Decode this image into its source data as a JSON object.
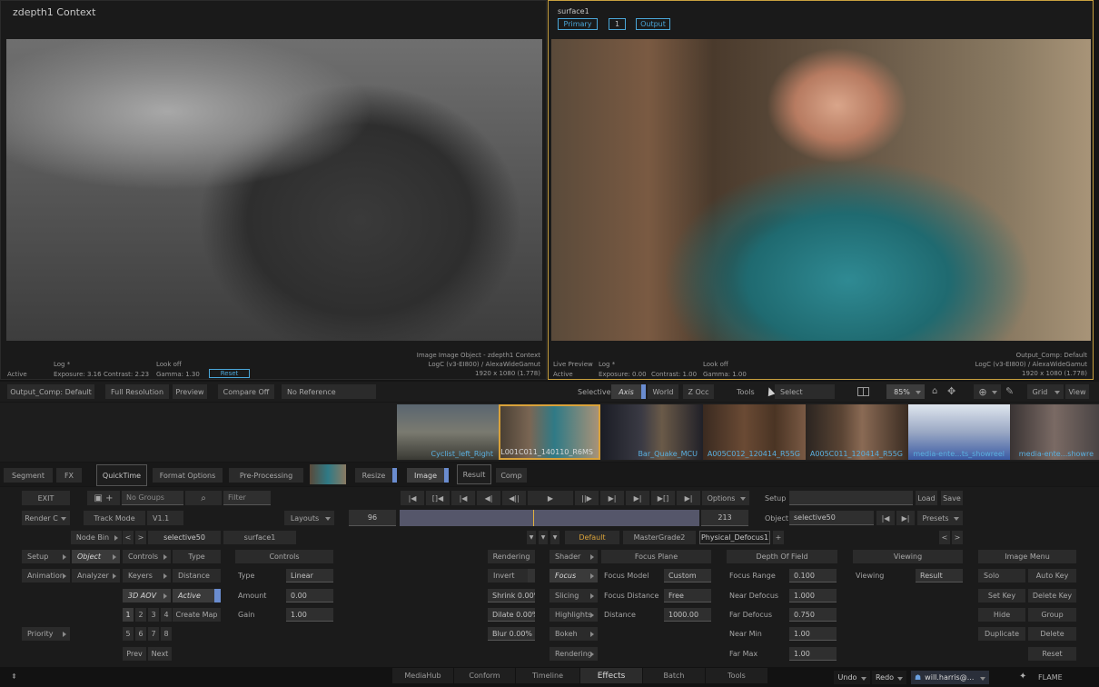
{
  "left_viewer": {
    "title": "zdepth1 Context",
    "log": "Log *",
    "look": "Look off",
    "status": "Active",
    "exposure": "Exposure: 3.16",
    "contrast": "Contrast: 2.23",
    "gamma": "Gamma: 1.30",
    "reset": "Reset",
    "info1": "Image Image Object - zdepth1 Context",
    "info2": "LogC (v3-EI800) / AlexaWideGamut",
    "info3": "1920 x 1080 (1.778)"
  },
  "right_viewer": {
    "title": "surface1",
    "btn_primary": "Primary",
    "btn_num": "1",
    "btn_output": "Output",
    "live": "Live Preview",
    "log": "Log *",
    "look": "Look off",
    "status": "Active",
    "exposure": "Exposure: 0.00",
    "contrast": "Contrast: 1.00",
    "gamma": "Gamma: 1.00",
    "info1": "Output_Comp: Default",
    "info2": "LogC (v3-EI800) / AlexaWideGamut",
    "info3": "1920 x 1080 (1.778)"
  },
  "viewer_bar": {
    "output": "Output_Comp: Default",
    "full_res": "Full Resolution",
    "preview": "Preview",
    "compare": "Compare Off",
    "noref": "No Reference",
    "selective": "Selective",
    "axis": "Axis",
    "world": "World",
    "zocc": "Z Occ",
    "tools": "Tools",
    "select": "Select",
    "zoom": "85%",
    "grid": "Grid",
    "view": "View"
  },
  "thumbs": [
    "Cyclist_left_Right",
    "L001C011_140110_R6MS",
    "Bar_Quake_MCU",
    "A005C012_120414_R55G",
    "A005C011_120414_R55G",
    "media-ente...ts_showreel",
    "media-ente...showre"
  ],
  "pipeline": {
    "segment": "Segment",
    "fx": "FX",
    "quicktime": "QuickTime",
    "format": "Format Options",
    "pre": "Pre-Processing",
    "resize": "Resize",
    "image": "Image",
    "result": "Result",
    "comp": "Comp"
  },
  "row1": {
    "exit": "EXIT",
    "groups": "No Groups",
    "filter": "Filter",
    "options": "Options",
    "setup": "Setup",
    "load": "Load",
    "save": "Save"
  },
  "row2": {
    "render": "Render C",
    "track": "Track Mode",
    "version": "V1.1",
    "layouts": "Layouts",
    "frame_start": "96",
    "frame_end": "213",
    "object_label": "Object",
    "object_val": "selective50",
    "presets": "Presets"
  },
  "row3": {
    "nodebin": "Node Bin",
    "selective": "selective50",
    "surface": "surface1",
    "default": "Default",
    "mastergrade": "MasterGrade2",
    "defocus": "Physical_Defocus1"
  },
  "col1": {
    "setup": "Setup",
    "object": "Object",
    "animation": "Animation",
    "analyzer": "Analyzer",
    "priority": "Priority"
  },
  "col2": {
    "controls": "Controls",
    "type": "Type",
    "keyers": "Keyers",
    "distance": "Distance",
    "aov": "3D AOV",
    "active": "Active",
    "n1": "1",
    "n2": "2",
    "n3": "3",
    "n4": "4",
    "create_map": "Create Map",
    "n5": "5",
    "n6": "6",
    "n7": "7",
    "n8": "8",
    "prev": "Prev",
    "next": "Next"
  },
  "controls": {
    "header": "Controls",
    "type_lbl": "Type",
    "type_val": "Linear",
    "amount_lbl": "Amount",
    "amount_val": "0.00",
    "gain_lbl": "Gain",
    "gain_val": "1.00"
  },
  "rendering": {
    "header": "Rendering",
    "invert": "Invert",
    "shrink": "Shrink 0.00%",
    "dilate": "Dilate 0.00%",
    "blur": "Blur 0.00%"
  },
  "shader": {
    "shader": "Shader",
    "focus": "Focus",
    "slicing": "Slicing",
    "highlights": "Highlights",
    "bokeh": "Bokeh",
    "rendering": "Rendering"
  },
  "focus_plane": {
    "header": "Focus Plane",
    "model_lbl": "Focus Model",
    "model_val": "Custom",
    "dist_lbl": "Focus Distance",
    "dist_val": "Free",
    "distance_lbl": "Distance",
    "distance_val": "1000.00"
  },
  "dof": {
    "header": "Depth Of Field",
    "range_lbl": "Focus Range",
    "range_val": "0.100",
    "near_lbl": "Near Defocus",
    "near_val": "1.000",
    "far_lbl": "Far Defocus",
    "far_val": "0.750",
    "nearmin_lbl": "Near Min",
    "nearmin_val": "1.00",
    "farmax_lbl": "Far Max",
    "farmax_val": "1.00"
  },
  "viewing": {
    "header": "Viewing",
    "lbl": "Viewing",
    "val": "Result"
  },
  "image_menu": {
    "header": "Image Menu",
    "solo": "Solo",
    "autokey": "Auto Key",
    "setkey": "Set Key",
    "deletekey": "Delete Key",
    "hide": "Hide",
    "group": "Group",
    "duplicate": "Duplicate",
    "delete": "Delete",
    "reset": "Reset"
  },
  "tabs": [
    "MediaHub",
    "Conform",
    "Timeline",
    "Effects",
    "Batch",
    "Tools"
  ],
  "bottom": {
    "undo": "Undo",
    "redo": "Redo",
    "user": "will.harris@...",
    "brand": "FLAME"
  }
}
